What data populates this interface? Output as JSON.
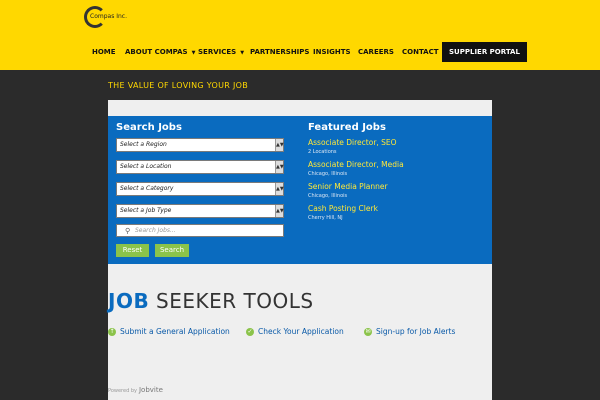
{
  "header": {
    "logo_text": "Compas Inc.",
    "nav": [
      {
        "label": "HOME",
        "caret": false
      },
      {
        "label": "ABOUT COMPAS",
        "caret": true
      },
      {
        "label": "SERVICES",
        "caret": true
      },
      {
        "label": "PARTNERSHIPS",
        "caret": false
      },
      {
        "label": "INSIGHTS",
        "caret": false
      },
      {
        "label": "CAREERS",
        "caret": false
      },
      {
        "label": "CONTACT",
        "caret": false
      },
      {
        "label": "SUPPLIER PORTAL",
        "caret": false
      }
    ]
  },
  "tagline": "THE VALUE OF LOVING YOUR JOB",
  "search": {
    "title": "Search Jobs",
    "selects": [
      "Select a Region",
      "Select a Location",
      "Select a Category",
      "Select a Job Type"
    ],
    "input_placeholder": "Search Jobs...",
    "reset_label": "Reset",
    "search_label": "Search"
  },
  "featured": {
    "title": "Featured Jobs",
    "jobs": [
      {
        "title": "Associate Director, SEO",
        "location": "2 Locations"
      },
      {
        "title": "Associate Director, Media",
        "location": "Chicago, Illinois"
      },
      {
        "title": "Senior Media Planner",
        "location": "Chicago, Illinois"
      },
      {
        "title": "Cash Posting Clerk",
        "location": "Cherry Hill, NJ"
      }
    ]
  },
  "tools": {
    "title_bold": "JOB",
    "title_rest": " SEEKER TOOLS",
    "links": [
      {
        "label": "Submit a General Application",
        "icon": "upload-icon"
      },
      {
        "label": "Check Your Application",
        "icon": "check-icon"
      },
      {
        "label": "Sign-up for Job Alerts",
        "icon": "mail-icon"
      }
    ]
  },
  "footer": {
    "powered_by": "Powered by",
    "brand": "Jobvite"
  },
  "colors": {
    "brand_yellow": "#ffd800",
    "brand_blue": "#0a6bbf",
    "button_green": "#8bc34a",
    "dark_bg": "#2b2b2b"
  }
}
